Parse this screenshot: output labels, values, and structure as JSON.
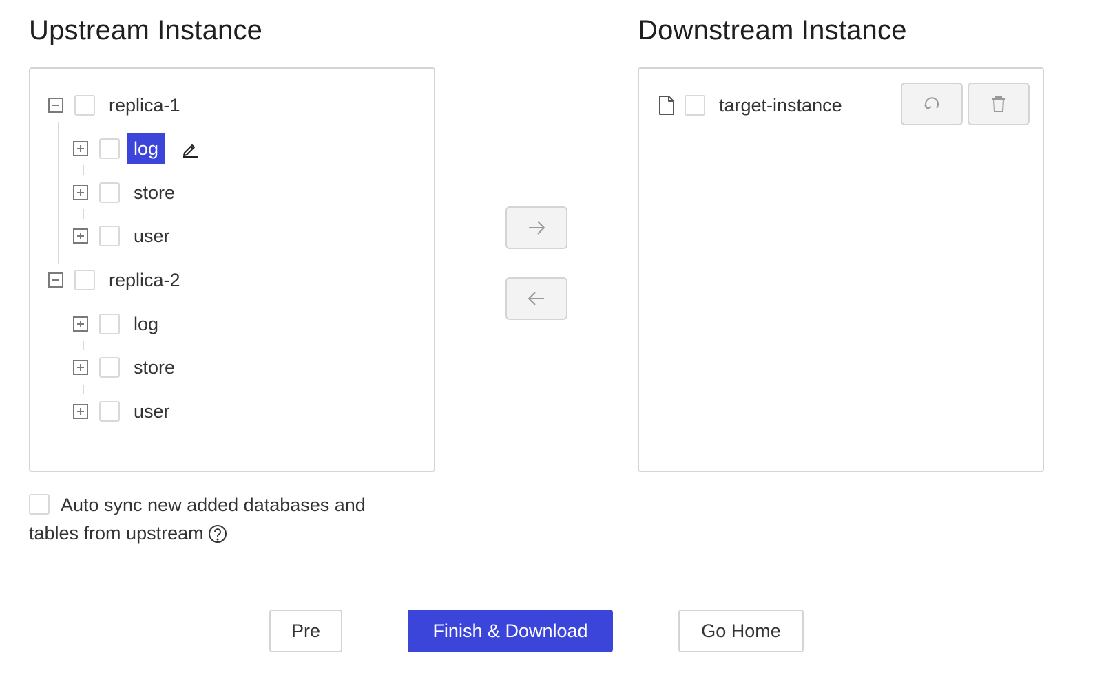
{
  "upstream": {
    "title": "Upstream Instance",
    "instances": [
      {
        "name": "replica-1",
        "expanded": true,
        "databases": [
          {
            "name": "log",
            "selected": true
          },
          {
            "name": "store",
            "selected": false
          },
          {
            "name": "user",
            "selected": false
          }
        ]
      },
      {
        "name": "replica-2",
        "expanded": true,
        "databases": [
          {
            "name": "log",
            "selected": false
          },
          {
            "name": "store",
            "selected": false
          },
          {
            "name": "user",
            "selected": false
          }
        ]
      }
    ]
  },
  "downstream": {
    "title": "Downstream Instance",
    "target": "target-instance"
  },
  "auto_sync": {
    "label": "Auto sync new added databases and tables from upstream",
    "checked": false
  },
  "footer": {
    "pre_label": "Pre",
    "finish_label": "Finish & Download",
    "home_label": "Go Home"
  },
  "colors": {
    "primary": "#3b45d9",
    "border": "#d4d4d4",
    "button_bg": "#f3f3f3",
    "text": "#333333"
  },
  "icons": {
    "collapse": "minus-square-icon",
    "expand": "plus-square-icon",
    "edit": "pencil-icon",
    "file": "file-icon",
    "refresh": "refresh-icon",
    "delete": "trash-icon",
    "move_right": "arrow-right-icon",
    "move_left": "arrow-left-icon",
    "help": "question-circle-icon"
  }
}
